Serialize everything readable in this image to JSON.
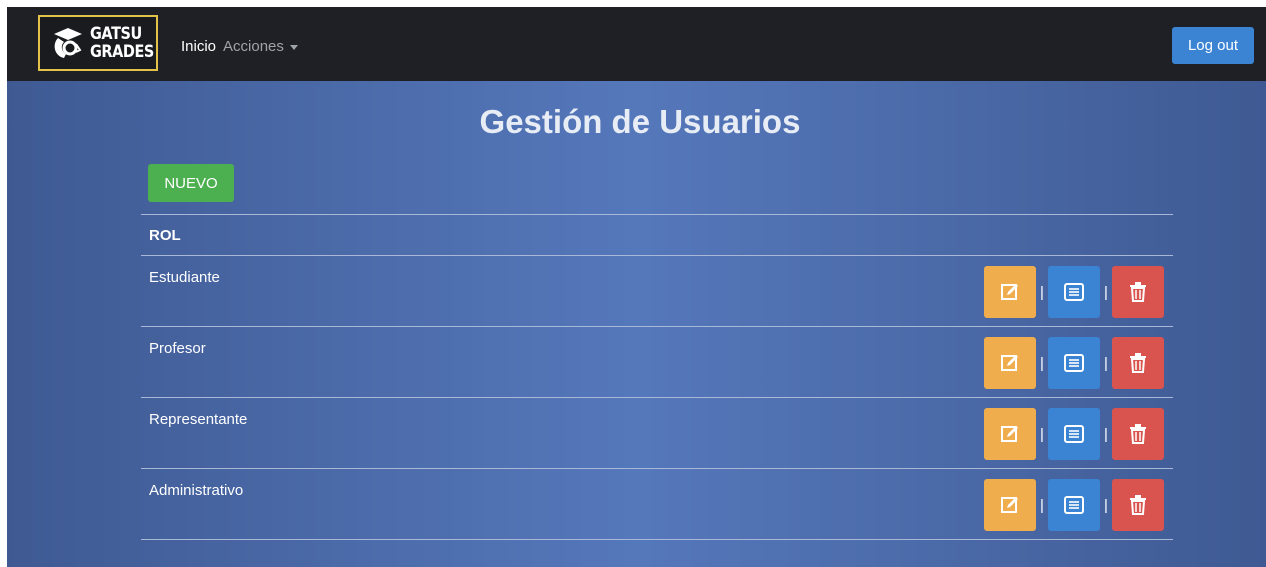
{
  "navbar": {
    "brand": {
      "line1": "GATSU",
      "line2": "GRADES",
      "icon": "graduate-head-icon"
    },
    "links": [
      {
        "label": "Inicio"
      },
      {
        "label": "Acciones",
        "dropdown": true
      }
    ],
    "logout_label": "Log out"
  },
  "main": {
    "title": "Gestión de Usuarios",
    "new_button_label": "NUEVO",
    "table": {
      "header": "ROL",
      "rows": [
        {
          "label": "Estudiante"
        },
        {
          "label": "Profesor"
        },
        {
          "label": "Representante"
        },
        {
          "label": "Administrativo"
        }
      ],
      "separator": "|",
      "actions": [
        "edit-icon",
        "list-icon",
        "trash-icon"
      ]
    }
  },
  "colors": {
    "navbar_bg": "#1f2025",
    "brand_border": "#e3c24a",
    "logout_bg": "#3b84d4",
    "nuevo_bg": "#4caf50",
    "edit_bg": "#f0ad4e",
    "detail_bg": "#3b84d4",
    "delete_bg": "#d9534f"
  }
}
